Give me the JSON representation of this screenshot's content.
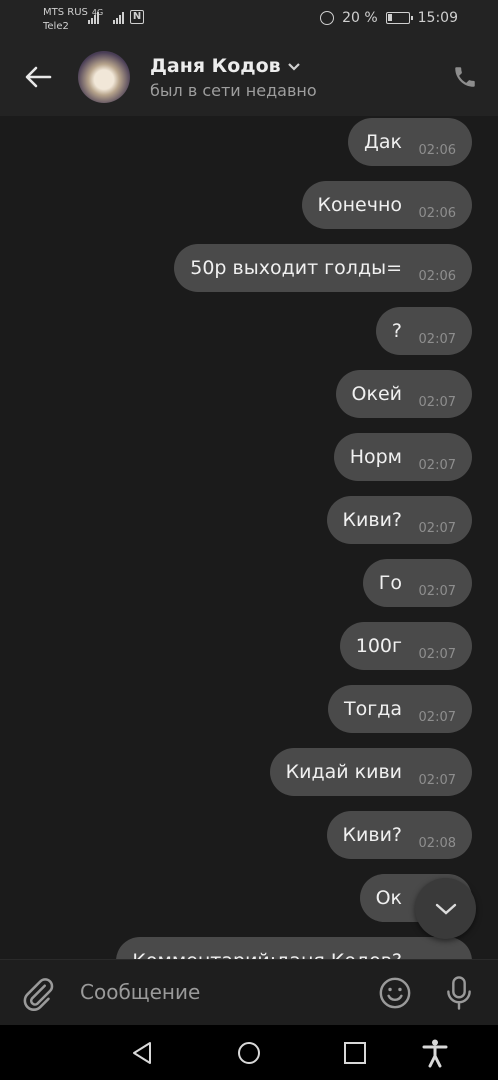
{
  "status": {
    "carrier1": "MTS RUS",
    "net1": "4G",
    "carrier2": "Tele2",
    "battery": "20 %",
    "battery_level": 0.2,
    "time": "15:09"
  },
  "header": {
    "title": "Даня Кодов",
    "subtitle": "был в сети недавно"
  },
  "messages": [
    {
      "text": "Дак",
      "time": "02:06"
    },
    {
      "text": "Конечно",
      "time": "02:06"
    },
    {
      "text": "50р выходит голды=",
      "time": "02:06"
    },
    {
      "text": "?",
      "time": "02:07"
    },
    {
      "text": "Окей",
      "time": "02:07"
    },
    {
      "text": "Норм",
      "time": "02:07"
    },
    {
      "text": "Киви?",
      "time": "02:07"
    },
    {
      "text": "Го",
      "time": "02:07"
    },
    {
      "text": "100г",
      "time": "02:07"
    },
    {
      "text": "Тогда",
      "time": "02:07"
    },
    {
      "text": "Кидай киви",
      "time": "02:07"
    },
    {
      "text": "Киви?",
      "time": "02:08"
    },
    {
      "text": "Ок",
      "time": ""
    },
    {
      "text": "Комментарий:даня Кодов?",
      "time": ""
    }
  ],
  "composer": {
    "placeholder": "Сообщение"
  },
  "icons": {
    "back": "arrow-left-icon",
    "phone": "phone-icon",
    "attach": "paperclip-icon",
    "emoji": "smile-icon",
    "mic": "microphone-icon",
    "scroll": "chevron-down-icon"
  }
}
